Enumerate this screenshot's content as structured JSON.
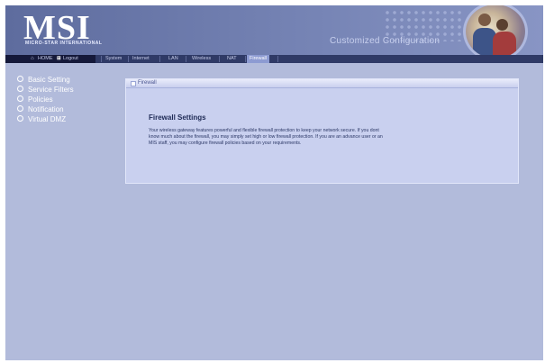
{
  "header": {
    "logo_text": "MSI",
    "logo_subtext": "MICRO-STAR INTERNATIONAL",
    "subtitle": "Customized Configuration"
  },
  "navbar": {
    "home_label": "HOME",
    "logout_label": "Logout",
    "tabs": [
      "System",
      "Internet",
      "LAN",
      "Wireless",
      "NAT",
      "Firewall"
    ],
    "active_tab": "Firewall"
  },
  "sidebar": {
    "items": [
      "Basic Setting",
      "Service Filters",
      "Policies",
      "Notification",
      "Virtual DMZ"
    ]
  },
  "panel": {
    "header": "Firewall",
    "title": "Firewall Settings",
    "description": "Your wireless gateway features powerful and flexible firewall protection to keep your network secure. If you dont know much about the firewall, you may simply set high or low firewall protection. If you are an advance user or an MIS staff, you may configure firewall policies based on your requirements."
  },
  "colors": {
    "header_bg": "#6876aa",
    "nav_bg": "#2f3a66",
    "content_bg": "#b2bbdb",
    "panel_bg": "#c9d0ef",
    "active_tab_bg": "#8d9bd2"
  }
}
